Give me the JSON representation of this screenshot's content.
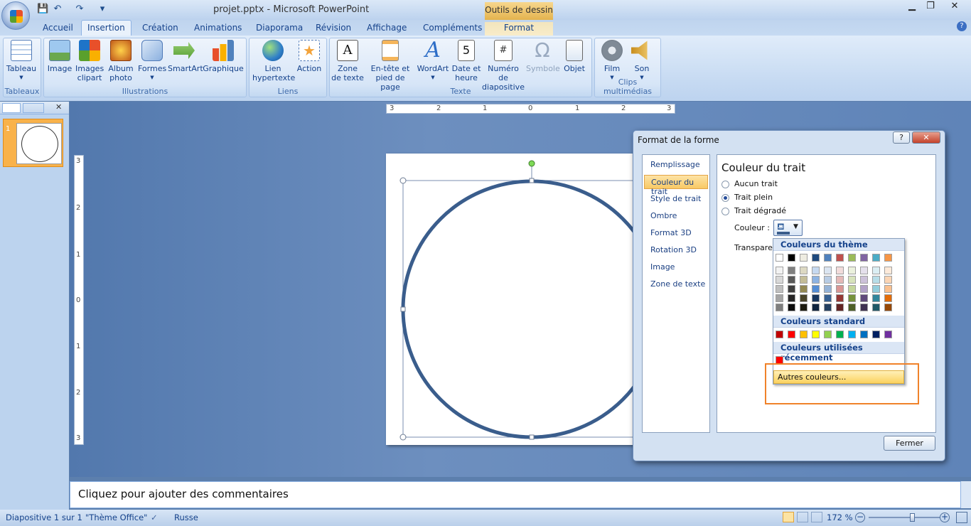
{
  "window": {
    "title": "projet.pptx - Microsoft PowerPoint",
    "contextual_title": "Outils de dessin",
    "minimize": "▁",
    "restore": "❐",
    "close": "✕"
  },
  "qat": [
    "💾",
    "↶",
    "↷",
    "▾"
  ],
  "tabs": [
    "Accueil",
    "Insertion",
    "Création",
    "Animations",
    "Diaporama",
    "Révision",
    "Affichage",
    "Compléments",
    "Format"
  ],
  "help": "?",
  "ribbon": {
    "groups": {
      "tableaux": "Tableaux",
      "illustrations": "Illustrations",
      "liens": "Liens",
      "texte": "Texte",
      "clips": "Clips multimédias"
    },
    "buttons": {
      "tableau": "Tableau",
      "image": "Image",
      "images_clipart_1": "Images",
      "images_clipart_2": "clipart",
      "album_1": "Album",
      "album_2": "photo",
      "formes": "Formes",
      "smartart": "SmartArt",
      "graphique": "Graphique",
      "lien_1": "Lien",
      "lien_2": "hypertexte",
      "action": "Action",
      "zone_1": "Zone",
      "zone_2": "de texte",
      "entete_1": "En-tête et",
      "entete_2": "pied de page",
      "wordart": "WordArt",
      "date_1": "Date et",
      "date_2": "heure",
      "numero_1": "Numéro de",
      "numero_2": "diapositive",
      "symbole": "Symbole",
      "objet": "Objet",
      "film": "Film",
      "son": "Son"
    }
  },
  "slides_pane": {
    "thumb_number": "1"
  },
  "ruler": {
    "h_ticks": [
      "3",
      "2",
      "1",
      "0",
      "1",
      "2",
      "3"
    ],
    "v_ticks": [
      "3",
      "2",
      "1",
      "0",
      "1",
      "2",
      "3"
    ]
  },
  "notes": {
    "placeholder": "Cliquez pour ajouter des commentaires"
  },
  "status": {
    "slide": "Diapositive 1 sur 1",
    "theme": "\"Thème Office\"",
    "language": "Russe",
    "zoom": "172 %",
    "zoom_level_percent": 172
  },
  "dialog": {
    "title": "Format de la forme",
    "help": "?",
    "close": "✕",
    "nav": [
      "Remplissage",
      "Couleur du trait",
      "Style de trait",
      "Ombre",
      "Format 3D",
      "Rotation 3D",
      "Image",
      "Zone de texte"
    ],
    "selected_nav": 1,
    "section_title": "Couleur du trait",
    "options": [
      "Aucun trait",
      "Trait plein",
      "Trait dégradé"
    ],
    "selected_option": 1,
    "couleur_label": "Couleur :",
    "transparence_label": "Transparen",
    "fermer": "Fermer"
  },
  "palette": {
    "theme_header": "Couleurs du thème",
    "standard_header": "Couleurs standard",
    "recent_header": "Couleurs utilisées récemment",
    "more_colors": "Autres couleurs...",
    "theme_top": [
      "#ffffff",
      "#000000",
      "#eeece1",
      "#1f497d",
      "#4f81bd",
      "#c0504d",
      "#9bbb59",
      "#8064a2",
      "#4bacc6",
      "#f79646"
    ],
    "theme_shades": [
      [
        "#f2f2f2",
        "#7f7f7f",
        "#ddd9c3",
        "#c6d9f0",
        "#dbe5f1",
        "#f2dcdb",
        "#ebf1dd",
        "#e5e0ec",
        "#dbeef3",
        "#fdeada"
      ],
      [
        "#d8d8d8",
        "#595959",
        "#c4bd97",
        "#8db3e2",
        "#b8cce4",
        "#e5b9b7",
        "#d7e3bc",
        "#ccc1d9",
        "#b7dde8",
        "#fbd5b5"
      ],
      [
        "#bfbfbf",
        "#3f3f3f",
        "#938953",
        "#548dd4",
        "#95b3d7",
        "#d99694",
        "#c3d69b",
        "#b2a2c7",
        "#92cddc",
        "#fac08f"
      ],
      [
        "#a5a5a5",
        "#262626",
        "#494429",
        "#17365d",
        "#366092",
        "#953734",
        "#76923c",
        "#5f497a",
        "#31859b",
        "#e36c09"
      ],
      [
        "#7f7f7f",
        "#0c0c0c",
        "#1d1b10",
        "#0f243e",
        "#244061",
        "#632423",
        "#4f6128",
        "#3f3151",
        "#205867",
        "#974806"
      ]
    ],
    "standard": [
      "#c00000",
      "#ff0000",
      "#ffc000",
      "#ffff00",
      "#92d050",
      "#00b050",
      "#00b0f0",
      "#0070c0",
      "#002060",
      "#7030a0"
    ],
    "recent": [
      "#ff0000"
    ]
  },
  "colors": {
    "circle_stroke": "#3a5d8c",
    "handle_green": "#7ed957",
    "highlight": "#f0822a"
  }
}
